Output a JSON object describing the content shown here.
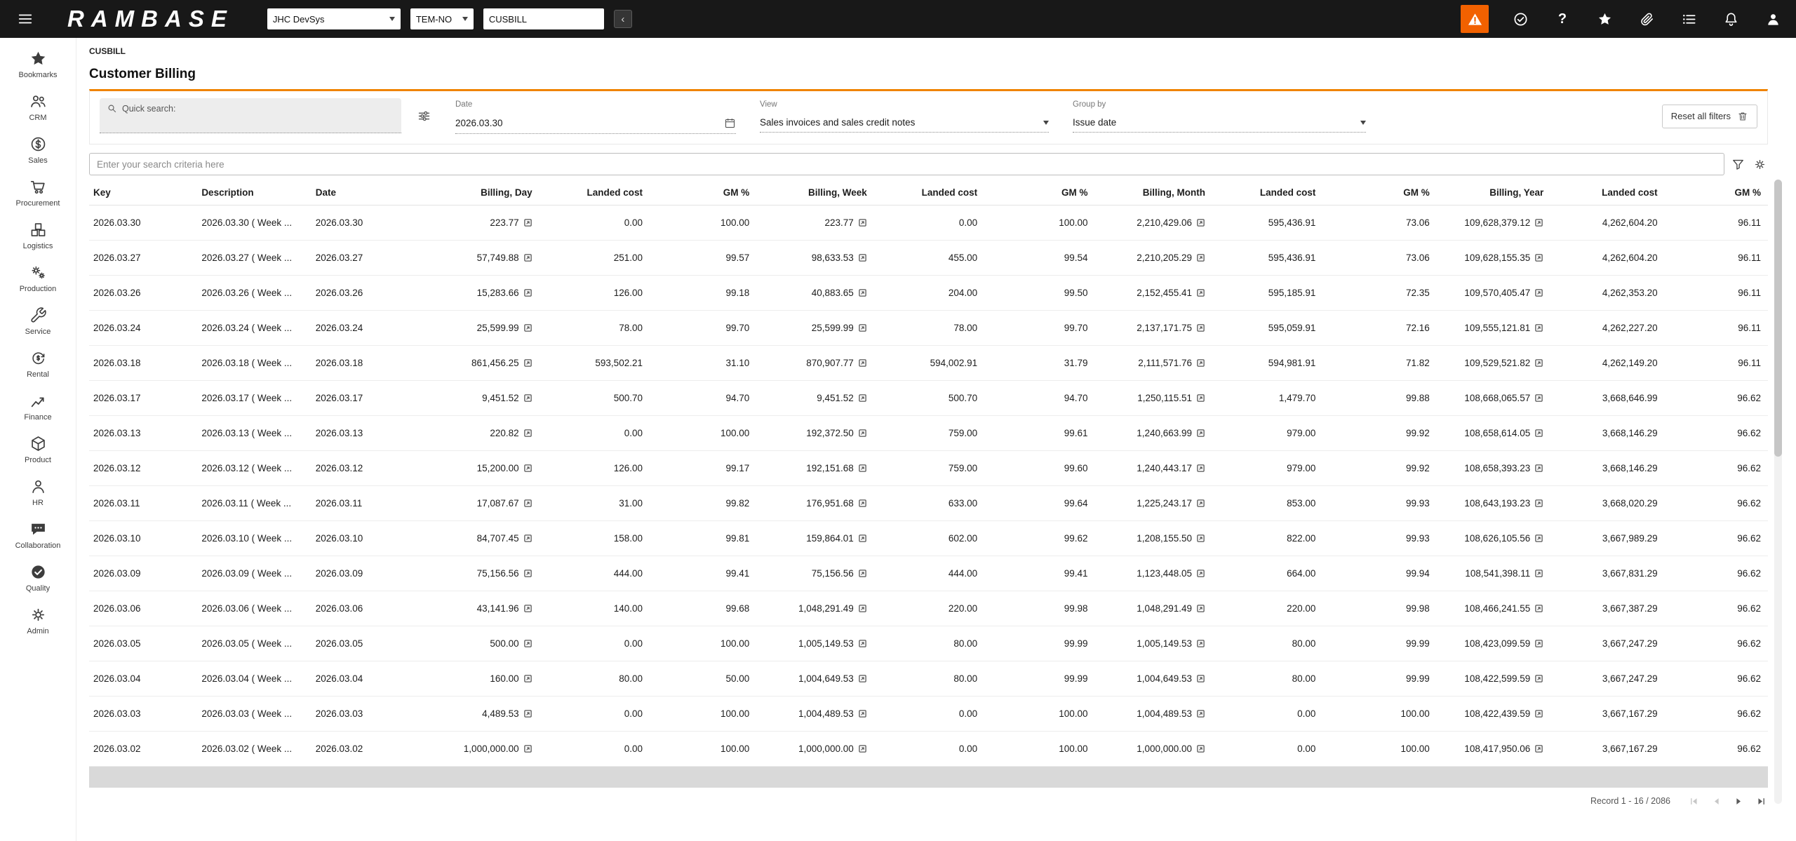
{
  "colors": {
    "topbar_bg": "#181818",
    "accent_orange": "#f08300",
    "warning_orange": "#f26100"
  },
  "topbar": {
    "logo": "RAMBASE",
    "system_select": "JHC DevSys",
    "company_select": "TEM-NO",
    "search_value": "CUSBILL",
    "collapse_glyph": "‹",
    "help_glyph": "?",
    "right_icons": [
      "warning",
      "target-check",
      "help",
      "favorites",
      "attachments",
      "tasks",
      "notifications",
      "user"
    ]
  },
  "sidebar": {
    "items": [
      {
        "label": "Bookmarks",
        "icon": "star-icon"
      },
      {
        "label": "CRM",
        "icon": "people-icon"
      },
      {
        "label": "Sales",
        "icon": "dollar-circle-icon"
      },
      {
        "label": "Procurement",
        "icon": "cart-icon"
      },
      {
        "label": "Logistics",
        "icon": "boxes-icon"
      },
      {
        "label": "Production",
        "icon": "gears-icon"
      },
      {
        "label": "Service",
        "icon": "wrench-icon"
      },
      {
        "label": "Rental",
        "icon": "renew-dollar-icon"
      },
      {
        "label": "Finance",
        "icon": "chart-up-icon"
      },
      {
        "label": "Product",
        "icon": "cube-icon"
      },
      {
        "label": "HR",
        "icon": "person-icon"
      },
      {
        "label": "Collaboration",
        "icon": "chat-icon"
      },
      {
        "label": "Quality",
        "icon": "check-circle-icon"
      },
      {
        "label": "Admin",
        "icon": "gear-icon"
      }
    ]
  },
  "breadcrumb": "CUSBILL",
  "page_title": "Customer Billing",
  "filters": {
    "quick_search_label": "Quick search:",
    "date_label": "Date",
    "date_value": "2026.03.30",
    "view_label": "View",
    "view_value": "Sales invoices and sales credit notes",
    "group_by_label": "Group by",
    "group_by_value": "Issue date",
    "reset_button": "Reset all filters"
  },
  "search": {
    "placeholder": "Enter your search criteria here"
  },
  "table": {
    "columns": [
      {
        "label": "Key",
        "align": "left",
        "link": false
      },
      {
        "label": "Description",
        "align": "left",
        "link": false
      },
      {
        "label": "Date",
        "align": "left",
        "link": false
      },
      {
        "label": "Billing, Day",
        "align": "right",
        "link": true
      },
      {
        "label": "Landed cost",
        "align": "right",
        "link": false
      },
      {
        "label": "GM %",
        "align": "right",
        "link": false
      },
      {
        "label": "Billing, Week",
        "align": "right",
        "link": true
      },
      {
        "label": "Landed cost",
        "align": "right",
        "link": false
      },
      {
        "label": "GM %",
        "align": "right",
        "link": false
      },
      {
        "label": "Billing, Month",
        "align": "right",
        "link": true
      },
      {
        "label": "Landed cost",
        "align": "right",
        "link": false
      },
      {
        "label": "GM %",
        "align": "right",
        "link": false
      },
      {
        "label": "Billing, Year",
        "align": "right",
        "link": true
      },
      {
        "label": "Landed cost",
        "align": "right",
        "link": false
      },
      {
        "label": "GM %",
        "align": "right",
        "link": false
      }
    ],
    "rows": [
      [
        "2026.03.30",
        "2026.03.30 ( Week ...",
        "2026.03.30",
        "223.77",
        "0.00",
        "100.00",
        "223.77",
        "0.00",
        "100.00",
        "2,210,429.06",
        "595,436.91",
        "73.06",
        "109,628,379.12",
        "4,262,604.20",
        "96.11"
      ],
      [
        "2026.03.27",
        "2026.03.27 ( Week ...",
        "2026.03.27",
        "57,749.88",
        "251.00",
        "99.57",
        "98,633.53",
        "455.00",
        "99.54",
        "2,210,205.29",
        "595,436.91",
        "73.06",
        "109,628,155.35",
        "4,262,604.20",
        "96.11"
      ],
      [
        "2026.03.26",
        "2026.03.26 ( Week ...",
        "2026.03.26",
        "15,283.66",
        "126.00",
        "99.18",
        "40,883.65",
        "204.00",
        "99.50",
        "2,152,455.41",
        "595,185.91",
        "72.35",
        "109,570,405.47",
        "4,262,353.20",
        "96.11"
      ],
      [
        "2026.03.24",
        "2026.03.24 ( Week ...",
        "2026.03.24",
        "25,599.99",
        "78.00",
        "99.70",
        "25,599.99",
        "78.00",
        "99.70",
        "2,137,171.75",
        "595,059.91",
        "72.16",
        "109,555,121.81",
        "4,262,227.20",
        "96.11"
      ],
      [
        "2026.03.18",
        "2026.03.18 ( Week ...",
        "2026.03.18",
        "861,456.25",
        "593,502.21",
        "31.10",
        "870,907.77",
        "594,002.91",
        "31.79",
        "2,111,571.76",
        "594,981.91",
        "71.82",
        "109,529,521.82",
        "4,262,149.20",
        "96.11"
      ],
      [
        "2026.03.17",
        "2026.03.17 ( Week ...",
        "2026.03.17",
        "9,451.52",
        "500.70",
        "94.70",
        "9,451.52",
        "500.70",
        "94.70",
        "1,250,115.51",
        "1,479.70",
        "99.88",
        "108,668,065.57",
        "3,668,646.99",
        "96.62"
      ],
      [
        "2026.03.13",
        "2026.03.13 ( Week ...",
        "2026.03.13",
        "220.82",
        "0.00",
        "100.00",
        "192,372.50",
        "759.00",
        "99.61",
        "1,240,663.99",
        "979.00",
        "99.92",
        "108,658,614.05",
        "3,668,146.29",
        "96.62"
      ],
      [
        "2026.03.12",
        "2026.03.12 ( Week ...",
        "2026.03.12",
        "15,200.00",
        "126.00",
        "99.17",
        "192,151.68",
        "759.00",
        "99.60",
        "1,240,443.17",
        "979.00",
        "99.92",
        "108,658,393.23",
        "3,668,146.29",
        "96.62"
      ],
      [
        "2026.03.11",
        "2026.03.11 ( Week ...",
        "2026.03.11",
        "17,087.67",
        "31.00",
        "99.82",
        "176,951.68",
        "633.00",
        "99.64",
        "1,225,243.17",
        "853.00",
        "99.93",
        "108,643,193.23",
        "3,668,020.29",
        "96.62"
      ],
      [
        "2026.03.10",
        "2026.03.10 ( Week ...",
        "2026.03.10",
        "84,707.45",
        "158.00",
        "99.81",
        "159,864.01",
        "602.00",
        "99.62",
        "1,208,155.50",
        "822.00",
        "99.93",
        "108,626,105.56",
        "3,667,989.29",
        "96.62"
      ],
      [
        "2026.03.09",
        "2026.03.09 ( Week ...",
        "2026.03.09",
        "75,156.56",
        "444.00",
        "99.41",
        "75,156.56",
        "444.00",
        "99.41",
        "1,123,448.05",
        "664.00",
        "99.94",
        "108,541,398.11",
        "3,667,831.29",
        "96.62"
      ],
      [
        "2026.03.06",
        "2026.03.06 ( Week ...",
        "2026.03.06",
        "43,141.96",
        "140.00",
        "99.68",
        "1,048,291.49",
        "220.00",
        "99.98",
        "1,048,291.49",
        "220.00",
        "99.98",
        "108,466,241.55",
        "3,667,387.29",
        "96.62"
      ],
      [
        "2026.03.05",
        "2026.03.05 ( Week ...",
        "2026.03.05",
        "500.00",
        "0.00",
        "100.00",
        "1,005,149.53",
        "80.00",
        "99.99",
        "1,005,149.53",
        "80.00",
        "99.99",
        "108,423,099.59",
        "3,667,247.29",
        "96.62"
      ],
      [
        "2026.03.04",
        "2026.03.04 ( Week ...",
        "2026.03.04",
        "160.00",
        "80.00",
        "50.00",
        "1,004,649.53",
        "80.00",
        "99.99",
        "1,004,649.53",
        "80.00",
        "99.99",
        "108,422,599.59",
        "3,667,247.29",
        "96.62"
      ],
      [
        "2026.03.03",
        "2026.03.03 ( Week ...",
        "2026.03.03",
        "4,489.53",
        "0.00",
        "100.00",
        "1,004,489.53",
        "0.00",
        "100.00",
        "1,004,489.53",
        "0.00",
        "100.00",
        "108,422,439.59",
        "3,667,167.29",
        "96.62"
      ],
      [
        "2026.03.02",
        "2026.03.02 ( Week ...",
        "2026.03.02",
        "1,000,000.00",
        "0.00",
        "100.00",
        "1,000,000.00",
        "0.00",
        "100.00",
        "1,000,000.00",
        "0.00",
        "100.00",
        "108,417,950.06",
        "3,667,167.29",
        "96.62"
      ]
    ]
  },
  "pagination": {
    "record_text": "Record 1 - 16 / 2086"
  }
}
